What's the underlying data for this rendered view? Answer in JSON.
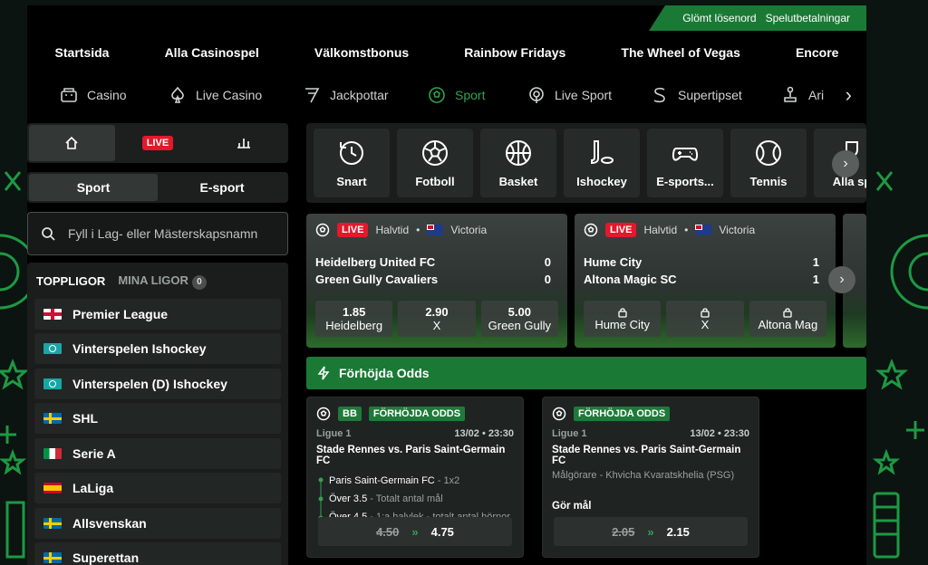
{
  "util": {
    "forgot_password": "Glömt lösenord",
    "game_pause": "Spelutbetalningar"
  },
  "top_nav": [
    "Startsida",
    "Alla Casinospel",
    "Välkomstbonus",
    "Rainbow Fridays",
    "The Wheel of Vegas",
    "Encore"
  ],
  "cat_nav": [
    {
      "label": "Casino",
      "icon": "casino-icon"
    },
    {
      "label": "Live Casino",
      "icon": "spade-icon"
    },
    {
      "label": "Jackpottar",
      "icon": "seven-icon"
    },
    {
      "label": "Sport",
      "icon": "football-icon",
      "active": true
    },
    {
      "label": "Live Sport",
      "icon": "live-icon"
    },
    {
      "label": "Supertipset",
      "icon": "s-icon"
    },
    {
      "label": "Ari",
      "icon": "arcade-icon"
    }
  ],
  "sidebar": {
    "tabs": {
      "live": "LIVE"
    },
    "sport_tab": "Sport",
    "esport_tab": "E-sport",
    "search_placeholder": "Fyll i Lag- eller Mästerskapsnamn",
    "top_leagues": "TOPPLIGOR",
    "my_leagues": "MINA LIGOR",
    "my_leagues_count": "0",
    "leagues": [
      {
        "name": "Premier League",
        "flag": "england"
      },
      {
        "name": "Vinterspelen Ishockey",
        "flag": "world"
      },
      {
        "name": "Vinterspelen (D) Ishockey",
        "flag": "world"
      },
      {
        "name": "SHL",
        "flag": "sweden"
      },
      {
        "name": "Serie A",
        "flag": "italy"
      },
      {
        "name": "LaLiga",
        "flag": "spain"
      },
      {
        "name": "Allsvenskan",
        "flag": "sweden"
      },
      {
        "name": "Superettan",
        "flag": "sweden"
      }
    ]
  },
  "sports": [
    "Snart",
    "Fotboll",
    "Basket",
    "Ishockey",
    "E-sports...",
    "Tennis",
    "Alla sp"
  ],
  "live_matches": [
    {
      "live": "LIVE",
      "status": "Halvtid",
      "region": "Victoria",
      "home": "Heidelberg United FC",
      "away": "Green Gully Cavaliers",
      "home_score": "0",
      "away_score": "0",
      "odds": [
        {
          "value": "1.85",
          "label": "Heidelberg"
        },
        {
          "value": "2.90",
          "label": "X"
        },
        {
          "value": "5.00",
          "label": "Green Gully"
        }
      ]
    },
    {
      "live": "LIVE",
      "status": "Halvtid",
      "region": "Victoria",
      "home": "Hume City",
      "away": "Altona Magic SC",
      "home_score": "1",
      "away_score": "1",
      "odds": [
        {
          "label": "Hume City",
          "locked": true
        },
        {
          "label": "X",
          "locked": true
        },
        {
          "label": "Altona Mag",
          "locked": true
        }
      ]
    }
  ],
  "boost_header": "Förhöjda Odds",
  "boosts": [
    {
      "bb": "BB",
      "tag": "FÖRHÖJDA ODDS",
      "league": "Ligue 1",
      "time": "13/02 • 23:30",
      "title": "Stade Rennes vs. Paris Saint-Germain FC",
      "selections": [
        {
          "main": "Paris Saint-Germain FC",
          "dim": " - 1x2"
        },
        {
          "main": "Över 3.5",
          "dim": " - Totalt antal mål"
        },
        {
          "main": "Över 4.5",
          "dim": " - 1:a halvlek - totalt antal hörnor"
        }
      ],
      "old_odds": "4.50",
      "new_odds": "4.75"
    },
    {
      "tag": "FÖRHÖJDA ODDS",
      "league": "Ligue 1",
      "time": "13/02 • 23:30",
      "title": "Stade Rennes vs. Paris Saint-Germain FC",
      "subtitle": "Målgörare - Khvicha Kvaratskhelia (PSG)",
      "market": "Gör mål",
      "old_odds": "2.05",
      "new_odds": "2.15"
    }
  ],
  "colors": {
    "accent": "#1a7a35",
    "live": "#e3192b",
    "active_nav": "#2fa34f"
  }
}
